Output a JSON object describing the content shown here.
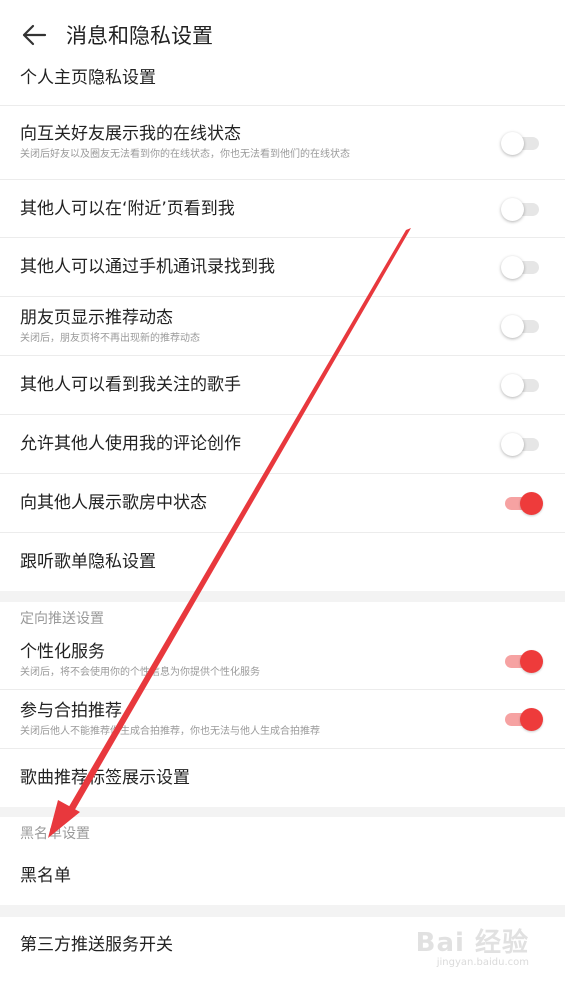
{
  "header": {
    "title": "消息和隐私设置"
  },
  "profile_privacy": {
    "label": "个人主页隐私设置",
    "items": [
      {
        "title": "向互关好友展示我的在线状态",
        "subtitle": "关闭后好友以及圈友无法看到你的在线状态，你也无法看到他们的在线状态",
        "toggle": "off"
      },
      {
        "title": "其他人可以在‘附近’页看到我",
        "toggle": "off"
      },
      {
        "title": "其他人可以通过手机通讯录找到我",
        "toggle": "off"
      },
      {
        "title": "朋友页显示推荐动态",
        "subtitle": "关闭后，朋友页将不再出现新的推荐动态",
        "toggle": "off"
      },
      {
        "title": "其他人可以看到我关注的歌手",
        "toggle": "off"
      },
      {
        "title": "允许其他人使用我的评论创作",
        "toggle": "off"
      },
      {
        "title": "向其他人展示歌房中状态",
        "toggle": "on"
      },
      {
        "title": "跟听歌单隐私设置"
      }
    ]
  },
  "targeted_push": {
    "label": "定向推送设置",
    "items": [
      {
        "title": "个性化服务",
        "subtitle": "关闭后，将不会使用你的个性信息为你提供个性化服务",
        "toggle": "on"
      },
      {
        "title": "参与合拍推荐",
        "subtitle": "关闭后他人不能推荐你生成合拍推荐，你也无法与他人生成合拍推荐",
        "toggle": "on"
      },
      {
        "title": "歌曲推荐标签展示设置"
      }
    ]
  },
  "blacklist": {
    "label": "黑名单设置",
    "items": [
      {
        "title": "黑名单"
      }
    ]
  },
  "third_party": {
    "items": [
      {
        "title": "第三方推送服务开关"
      }
    ]
  },
  "watermark": {
    "logo": "Bai 经验",
    "url": "jingyan.baidu.com"
  },
  "colors": {
    "accent": "#ee3b3b",
    "annotation_arrow": "#e8383d"
  }
}
